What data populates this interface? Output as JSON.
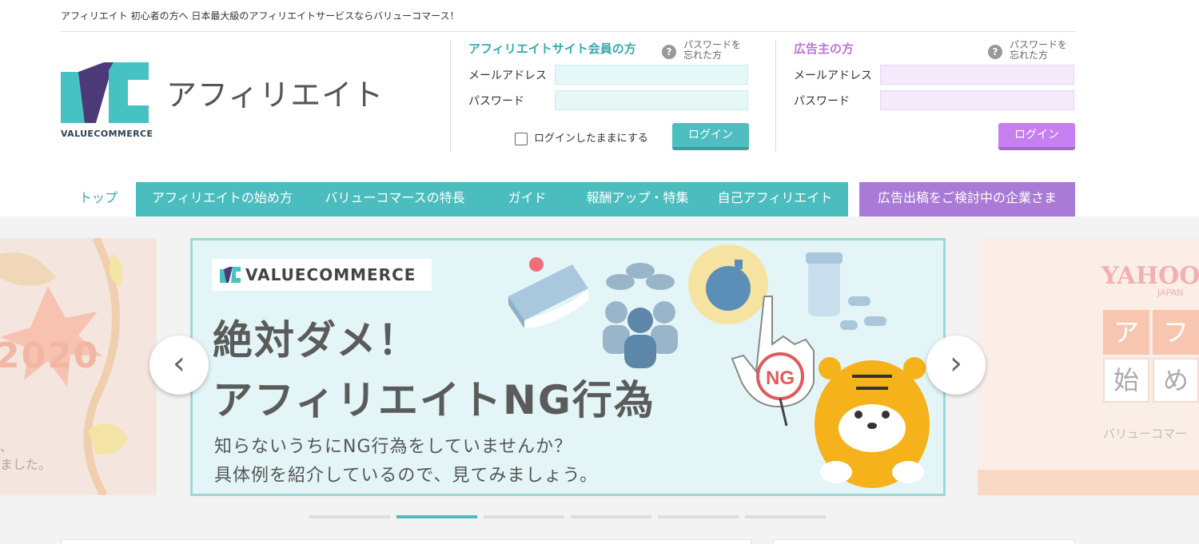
{
  "topbar": {
    "text": "アフィリエイト 初心者の方へ 日本最大級のアフィリエイトサービスならバリューコマース！"
  },
  "logo": {
    "brand": "VALUECOMMERCE",
    "title": "アフィリエイト",
    "colors": {
      "teal": "#47c2c3",
      "purple": "#4b3a77"
    }
  },
  "affiliate_login": {
    "title": "アフィリエイトサイト会員の方",
    "forgot": "パスワードを忘れた方",
    "email_label": "メールアドレス",
    "password_label": "パスワード",
    "keep_label": "ログインしたままにする",
    "button": "ログイン"
  },
  "advertiser_login": {
    "title": "広告主の方",
    "forgot": "パスワードを忘れた方",
    "email_label": "メールアドレス",
    "password_label": "パスワード",
    "button": "ログイン"
  },
  "nav": {
    "items": [
      {
        "label": "トップ"
      },
      {
        "label": "アフィリエイトの始め方"
      },
      {
        "label": "バリューコマースの特長"
      },
      {
        "label": "ガイド"
      },
      {
        "label": "報酬アップ・特集"
      },
      {
        "label": "自己アフィリエイト"
      }
    ],
    "cta": "広告出稿をご検討中の企業さま"
  },
  "carousel": {
    "main": {
      "badge": "VALUECOMMERCE",
      "headline1": "絶対ダメ！",
      "headline2": "アフィリエイトNG行為",
      "sub1": "知らないうちにNG行為をしていませんか？",
      "sub2": "具体例を紹介しているので、見てみましょう。",
      "ng_label": "NG"
    },
    "left": {
      "year": "2020",
      "text1": "、",
      "text2": "ました。"
    },
    "right": {
      "brand": "YAHOO!",
      "brand_sub": "JAPAN",
      "tile1": "ア",
      "tile2": "フ",
      "tile3": "始",
      "tile4": "め",
      "caption": "バリューコマー"
    },
    "prev_glyph": "‹",
    "next_glyph": "›",
    "active_index": 1,
    "total": 6
  }
}
